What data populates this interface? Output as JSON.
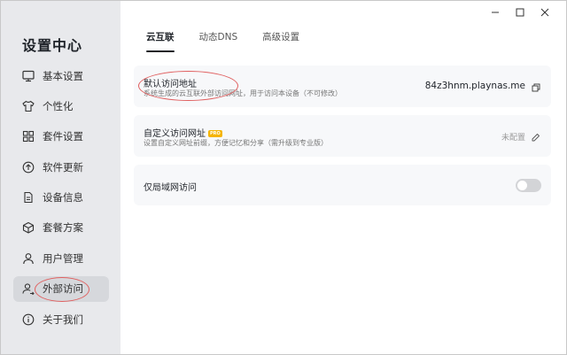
{
  "app": {
    "title": "设置中心"
  },
  "window_controls": [
    "minimize-icon",
    "maximize-icon",
    "close-icon"
  ],
  "sidebar": {
    "items": [
      {
        "label": "基本设置",
        "icon": "monitor-icon"
      },
      {
        "label": "个性化",
        "icon": "shirt-icon"
      },
      {
        "label": "套件设置",
        "icon": "grid-icon"
      },
      {
        "label": "软件更新",
        "icon": "upload-circle-icon"
      },
      {
        "label": "设备信息",
        "icon": "document-icon"
      },
      {
        "label": "套餐方案",
        "icon": "package-icon"
      },
      {
        "label": "用户管理",
        "icon": "user-icon"
      },
      {
        "label": "外部访问",
        "icon": "external-user-icon",
        "active": true
      },
      {
        "label": "关于我们",
        "icon": "info-icon"
      }
    ]
  },
  "tabs": [
    {
      "label": "云互联",
      "active": true
    },
    {
      "label": "动态DNS"
    },
    {
      "label": "高级设置"
    }
  ],
  "cards": {
    "default_address": {
      "title": "默认访问地址",
      "desc": "系统生成的云互联外部访问网址，用于访问本设备（不可修改）",
      "value": "84z3hnm.playnas.me",
      "icon": "copy-icon"
    },
    "custom_address": {
      "title": "自定义访问网址",
      "badge": "PRO",
      "desc": "设置自定义网址前缀，方便记忆和分享（需升级到专业版）",
      "status": "未配置",
      "icon": "edit-icon"
    },
    "lan_only": {
      "title": "仅局域网访问",
      "enabled": false
    }
  },
  "colors": {
    "accent": "#1f2329",
    "sidebar_bg": "#e8e9ec",
    "card_bg": "#f7f8fa",
    "pro_badge": "#f5b400",
    "highlight_ellipse": "#e06060"
  }
}
